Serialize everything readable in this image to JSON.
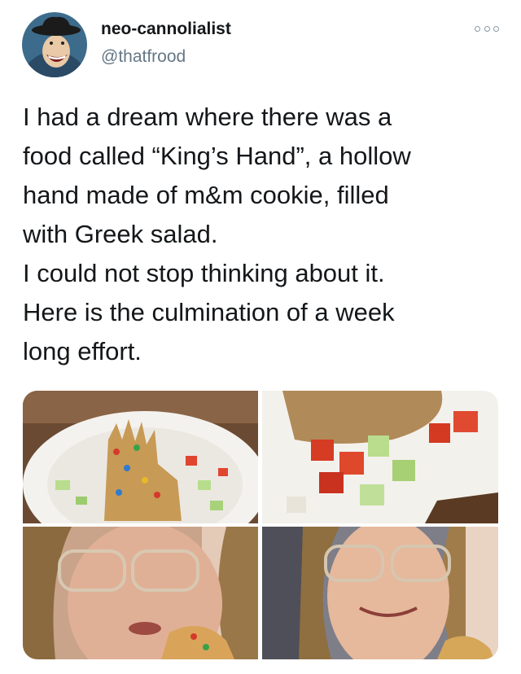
{
  "tweet": {
    "display_name": "neo-cannolialist",
    "handle": "@thatfrood",
    "more_icon": "more-options-icon",
    "text": "I had a dream where there was a\nfood called “King’s Hand”, a hollow\nhand made of m&m cookie, filled\nwith Greek salad.\nI could not stop thinking about it.\nHere is the culmination of a week\nlong effort."
  },
  "colors": {
    "text": "#14171a",
    "secondary": "#657786",
    "icon": "#8899a6",
    "avatar_bg": "#3d6b8c"
  },
  "media": [
    {
      "subject": "cookie-hand-plate"
    },
    {
      "subject": "greek-salad-closeup"
    },
    {
      "subject": "person-eating-cookie"
    },
    {
      "subject": "person-smiling"
    }
  ]
}
